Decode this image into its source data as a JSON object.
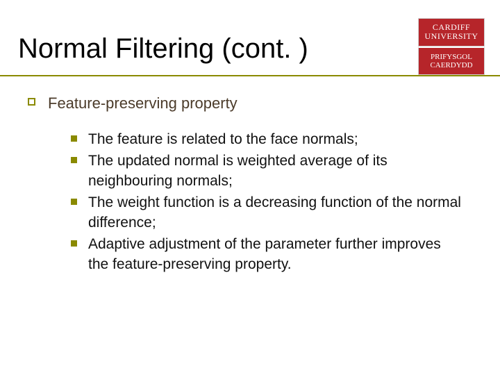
{
  "title": "Normal Filtering (cont. )",
  "logo": {
    "top_line1": "CARDIFF",
    "top_line2": "UNIVERSITY",
    "bottom_line1": "PRIFYSGOL",
    "bottom_line2": "CAERDYDD"
  },
  "lvl1": {
    "text": "Feature-preserving property"
  },
  "lvl2": [
    {
      "text": "The feature is related to the face normals;"
    },
    {
      "text": "The updated normal is weighted average of its neighbouring normals;"
    },
    {
      "text": "The weight function is a decreasing function of the normal difference;"
    },
    {
      "text": "Adaptive adjustment of the parameter further improves the feature-preserving property."
    }
  ]
}
